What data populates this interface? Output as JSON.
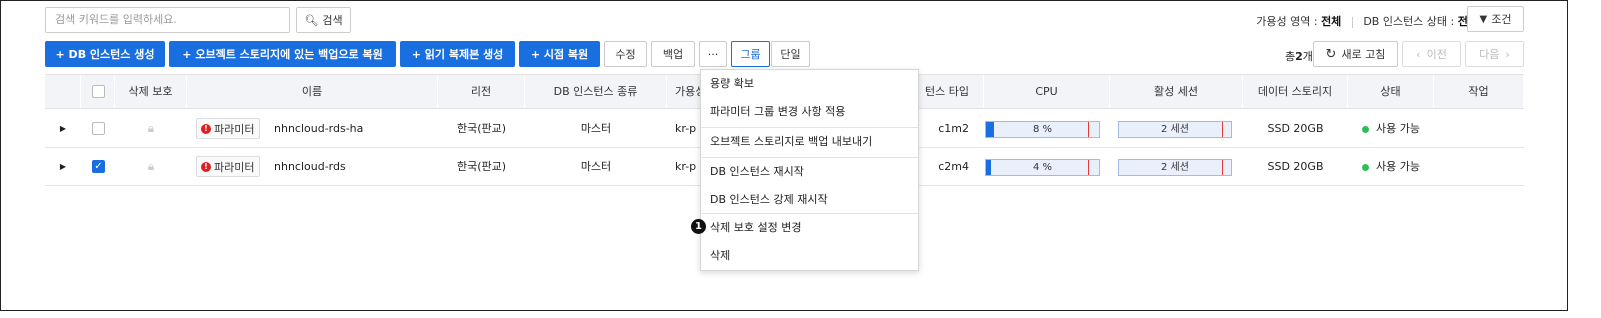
{
  "search": {
    "placeholder": "검색 키워드를 입력하세요.",
    "button_label": "검색"
  },
  "filters": {
    "zone_label": "가용성 영역 :",
    "zone_value": "전체",
    "state_label": "DB 인스턴스 상태 :",
    "state_value": "전체",
    "condition_label": "조건"
  },
  "toolbar": {
    "create_label": "+ DB 인스턴스 생성",
    "restore_backup_label": "+ 오브젝트 스토리지에 있는 백업으로 복원",
    "read_replica_label": "+ 읽기 복제본 생성",
    "pitr_label": "+ 시점 복원",
    "modify_label": "수정",
    "backup_label": "백업",
    "more_label": "···",
    "group_label": "그룹",
    "single_label": "단일",
    "total_prefix": "총",
    "total_count": "2",
    "total_suffix": "개",
    "refresh_label": "새로 고침",
    "prev_label": "이전",
    "next_label": "다음"
  },
  "table": {
    "headers": [
      "삭제 보호",
      "이름",
      "리전",
      "DB 인스턴스 종류",
      "가용성",
      "턴스 타입",
      "CPU",
      "활성 세션",
      "데이터 스토리지",
      "상태",
      "작업"
    ],
    "rows": [
      {
        "checked": false,
        "param_label": "파라미터",
        "name": "nhncloud-rds-ha",
        "region": "한국(판교)",
        "kind": "마스터",
        "zone": "kr-p",
        "type": "c1m2",
        "cpu": "8 %",
        "cpu_value": 8,
        "sessions": "2 세션",
        "storage": "SSD 20GB",
        "status": "사용 가능"
      },
      {
        "checked": true,
        "param_label": "파라미터",
        "name": "nhncloud-rds",
        "region": "한국(판교)",
        "kind": "마스터",
        "zone": "kr-p",
        "type": "c2m4",
        "cpu": "4 %",
        "cpu_value": 4,
        "sessions": "2 세션",
        "storage": "SSD 20GB",
        "status": "사용 가능"
      }
    ]
  },
  "menu": {
    "items": [
      "용량 확보",
      "파라미터 그룹 변경 사항 적용",
      "오브젝트 스토리지로 백업 내보내기",
      "DB 인스턴스 재시작",
      "DB 인스턴스 강제 재시작",
      "삭제 보호 설정 변경",
      "삭제"
    ]
  },
  "callout": "1",
  "colors": {
    "primary": "#1a6fe0",
    "status_ok": "#2ebd59",
    "error": "#e02020"
  }
}
